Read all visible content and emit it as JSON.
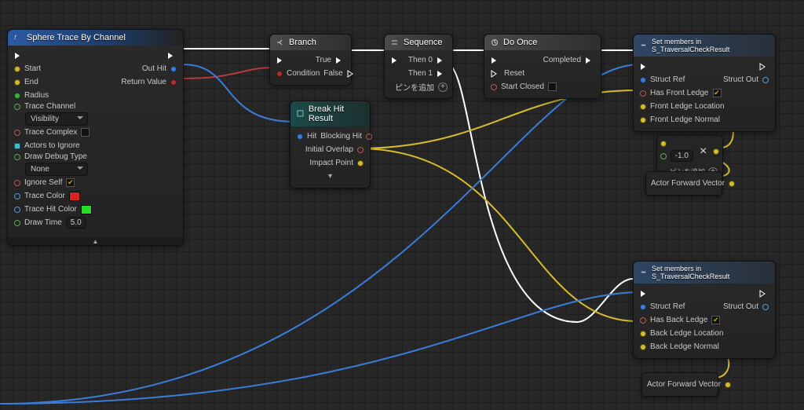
{
  "sphereTrace": {
    "title": "Sphere Trace By Channel",
    "start": "Start",
    "end": "End",
    "radius": "Radius",
    "traceChannelLabel": "Trace Channel",
    "traceChannelValue": "Visibility",
    "traceComplex": "Trace Complex",
    "actorsToIgnore": "Actors to Ignore",
    "drawDebugLabel": "Draw Debug Type",
    "drawDebugValue": "None",
    "ignoreSelf": "Ignore Self",
    "traceColor": "Trace Color",
    "traceHitColor": "Trace Hit Color",
    "drawTimeLabel": "Draw Time",
    "drawTimeValue": "5.0",
    "outHit": "Out Hit",
    "returnValue": "Return Value"
  },
  "branch": {
    "title": "Branch",
    "condition": "Condition",
    "true": "True",
    "false": "False"
  },
  "sequence": {
    "title": "Sequence",
    "then0": "Then 0",
    "then1": "Then 1",
    "addPin": "ピンを追加"
  },
  "doOnce": {
    "title": "Do Once",
    "reset": "Reset",
    "startClosed": "Start Closed",
    "completed": "Completed"
  },
  "breakHit": {
    "title": "Break Hit Result",
    "hit": "Hit",
    "blockingHit": "Blocking Hit",
    "initialOverlap": "Initial Overlap",
    "impactPoint": "Impact Point"
  },
  "setMembers1": {
    "title": "Set members in S_TraversalCheckResult",
    "structRef": "Struct Ref",
    "structOut": "Struct Out",
    "hasFrontLedge": "Has Front Ledge",
    "frontLedgeLocation": "Front Ledge Location",
    "frontLedgeNormal": "Front Ledge Normal"
  },
  "setMembers2": {
    "title": "Set members in S_TraversalCheckResult",
    "structRef": "Struct Ref",
    "structOut": "Struct Out",
    "hasBackLedge": "Has Back Ledge",
    "backLedgeLocation": "Back Ledge Location",
    "backLedgeNormal": "Back Ledge Normal"
  },
  "mult": {
    "value": "-1.0",
    "addPin": "ピンを追加"
  },
  "forward1": {
    "label": "Actor Forward Vector"
  },
  "forward2": {
    "label": "Actor Forward Vector"
  }
}
